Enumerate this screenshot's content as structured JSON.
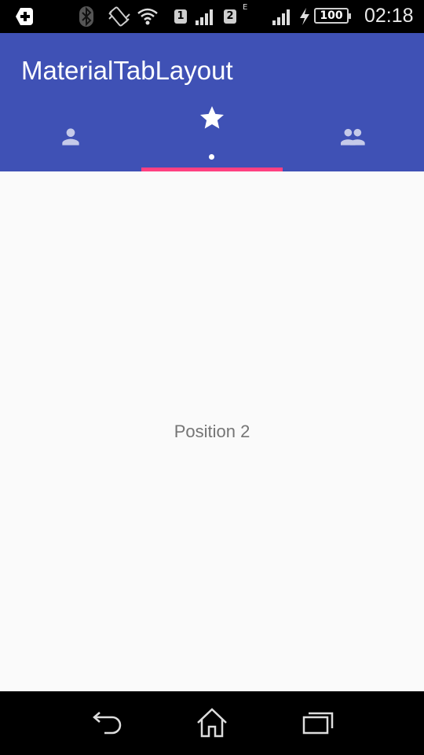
{
  "status_bar": {
    "sim1": "1",
    "sim2": "2",
    "network_type": "E",
    "battery": "100",
    "time": "02:18"
  },
  "app_bar": {
    "title": "MaterialTabLayout",
    "color": "#3f51b5",
    "tabs": [
      {
        "icon": "person-icon",
        "selected": false
      },
      {
        "icon": "star-icon",
        "selected": true
      },
      {
        "icon": "group-icon",
        "selected": false
      }
    ],
    "indicator_color": "#ff4081"
  },
  "content": {
    "label": "Position 2"
  },
  "nav_bar": {
    "buttons": [
      "back-icon",
      "home-icon",
      "recents-icon"
    ]
  }
}
